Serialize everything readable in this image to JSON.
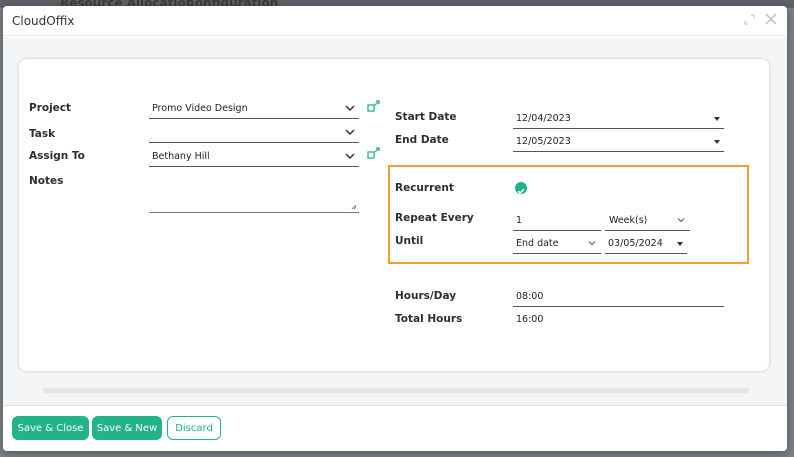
{
  "background": {
    "tabs": [
      "Resource Allocation",
      "Configuration"
    ]
  },
  "modal": {
    "title": "CloudOffix"
  },
  "form": {
    "project": {
      "label": "Project",
      "value": "Promo Video Design"
    },
    "task": {
      "label": "Task",
      "value": ""
    },
    "assign_to": {
      "label": "Assign To",
      "value": "Bethany Hill"
    },
    "notes": {
      "label": "Notes",
      "value": ""
    },
    "start_date": {
      "label": "Start Date",
      "value": "12/04/2023"
    },
    "end_date": {
      "label": "End Date",
      "value": "12/05/2023"
    },
    "recurrent": {
      "label": "Recurrent",
      "checked": true
    },
    "repeat_every": {
      "label": "Repeat Every",
      "value": "1",
      "unit": "Week(s)"
    },
    "until": {
      "label": "Until",
      "mode": "End date",
      "date": "03/05/2024"
    },
    "hours_per_day": {
      "label": "Hours/Day",
      "value": "08:00"
    },
    "total_hours": {
      "label": "Total Hours",
      "value": "16:00"
    }
  },
  "footer": {
    "save_close": "Save & Close",
    "save_new": "Save & New",
    "discard": "Discard"
  },
  "colors": {
    "accent": "#22b389",
    "highlight": "#f0a030"
  }
}
